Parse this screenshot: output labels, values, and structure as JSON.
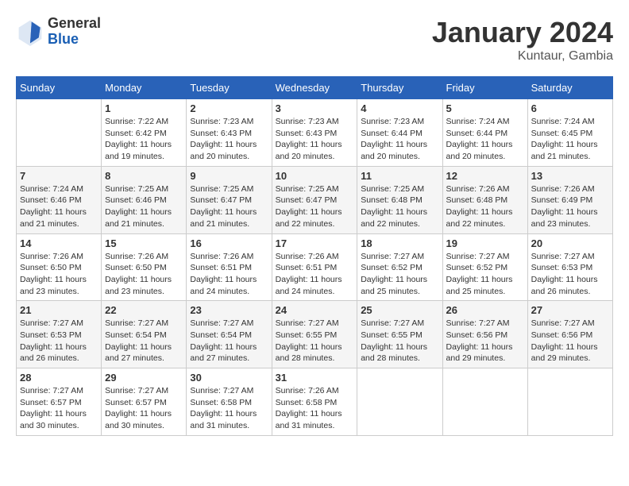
{
  "header": {
    "logo_general": "General",
    "logo_blue": "Blue",
    "month_title": "January 2024",
    "location": "Kuntaur, Gambia"
  },
  "days_of_week": [
    "Sunday",
    "Monday",
    "Tuesday",
    "Wednesday",
    "Thursday",
    "Friday",
    "Saturday"
  ],
  "weeks": [
    [
      {
        "day": "",
        "sunrise": "",
        "sunset": "",
        "daylight": ""
      },
      {
        "day": "1",
        "sunrise": "7:22 AM",
        "sunset": "6:42 PM",
        "daylight": "11 hours and 19 minutes."
      },
      {
        "day": "2",
        "sunrise": "7:23 AM",
        "sunset": "6:43 PM",
        "daylight": "11 hours and 20 minutes."
      },
      {
        "day": "3",
        "sunrise": "7:23 AM",
        "sunset": "6:43 PM",
        "daylight": "11 hours and 20 minutes."
      },
      {
        "day": "4",
        "sunrise": "7:23 AM",
        "sunset": "6:44 PM",
        "daylight": "11 hours and 20 minutes."
      },
      {
        "day": "5",
        "sunrise": "7:24 AM",
        "sunset": "6:44 PM",
        "daylight": "11 hours and 20 minutes."
      },
      {
        "day": "6",
        "sunrise": "7:24 AM",
        "sunset": "6:45 PM",
        "daylight": "11 hours and 21 minutes."
      }
    ],
    [
      {
        "day": "7",
        "sunrise": "7:24 AM",
        "sunset": "6:46 PM",
        "daylight": "11 hours and 21 minutes."
      },
      {
        "day": "8",
        "sunrise": "7:25 AM",
        "sunset": "6:46 PM",
        "daylight": "11 hours and 21 minutes."
      },
      {
        "day": "9",
        "sunrise": "7:25 AM",
        "sunset": "6:47 PM",
        "daylight": "11 hours and 21 minutes."
      },
      {
        "day": "10",
        "sunrise": "7:25 AM",
        "sunset": "6:47 PM",
        "daylight": "11 hours and 22 minutes."
      },
      {
        "day": "11",
        "sunrise": "7:25 AM",
        "sunset": "6:48 PM",
        "daylight": "11 hours and 22 minutes."
      },
      {
        "day": "12",
        "sunrise": "7:26 AM",
        "sunset": "6:48 PM",
        "daylight": "11 hours and 22 minutes."
      },
      {
        "day": "13",
        "sunrise": "7:26 AM",
        "sunset": "6:49 PM",
        "daylight": "11 hours and 23 minutes."
      }
    ],
    [
      {
        "day": "14",
        "sunrise": "7:26 AM",
        "sunset": "6:50 PM",
        "daylight": "11 hours and 23 minutes."
      },
      {
        "day": "15",
        "sunrise": "7:26 AM",
        "sunset": "6:50 PM",
        "daylight": "11 hours and 23 minutes."
      },
      {
        "day": "16",
        "sunrise": "7:26 AM",
        "sunset": "6:51 PM",
        "daylight": "11 hours and 24 minutes."
      },
      {
        "day": "17",
        "sunrise": "7:26 AM",
        "sunset": "6:51 PM",
        "daylight": "11 hours and 24 minutes."
      },
      {
        "day": "18",
        "sunrise": "7:27 AM",
        "sunset": "6:52 PM",
        "daylight": "11 hours and 25 minutes."
      },
      {
        "day": "19",
        "sunrise": "7:27 AM",
        "sunset": "6:52 PM",
        "daylight": "11 hours and 25 minutes."
      },
      {
        "day": "20",
        "sunrise": "7:27 AM",
        "sunset": "6:53 PM",
        "daylight": "11 hours and 26 minutes."
      }
    ],
    [
      {
        "day": "21",
        "sunrise": "7:27 AM",
        "sunset": "6:53 PM",
        "daylight": "11 hours and 26 minutes."
      },
      {
        "day": "22",
        "sunrise": "7:27 AM",
        "sunset": "6:54 PM",
        "daylight": "11 hours and 27 minutes."
      },
      {
        "day": "23",
        "sunrise": "7:27 AM",
        "sunset": "6:54 PM",
        "daylight": "11 hours and 27 minutes."
      },
      {
        "day": "24",
        "sunrise": "7:27 AM",
        "sunset": "6:55 PM",
        "daylight": "11 hours and 28 minutes."
      },
      {
        "day": "25",
        "sunrise": "7:27 AM",
        "sunset": "6:55 PM",
        "daylight": "11 hours and 28 minutes."
      },
      {
        "day": "26",
        "sunrise": "7:27 AM",
        "sunset": "6:56 PM",
        "daylight": "11 hours and 29 minutes."
      },
      {
        "day": "27",
        "sunrise": "7:27 AM",
        "sunset": "6:56 PM",
        "daylight": "11 hours and 29 minutes."
      }
    ],
    [
      {
        "day": "28",
        "sunrise": "7:27 AM",
        "sunset": "6:57 PM",
        "daylight": "11 hours and 30 minutes."
      },
      {
        "day": "29",
        "sunrise": "7:27 AM",
        "sunset": "6:57 PM",
        "daylight": "11 hours and 30 minutes."
      },
      {
        "day": "30",
        "sunrise": "7:27 AM",
        "sunset": "6:58 PM",
        "daylight": "11 hours and 31 minutes."
      },
      {
        "day": "31",
        "sunrise": "7:26 AM",
        "sunset": "6:58 PM",
        "daylight": "11 hours and 31 minutes."
      },
      {
        "day": "",
        "sunrise": "",
        "sunset": "",
        "daylight": ""
      },
      {
        "day": "",
        "sunrise": "",
        "sunset": "",
        "daylight": ""
      },
      {
        "day": "",
        "sunrise": "",
        "sunset": "",
        "daylight": ""
      }
    ]
  ]
}
